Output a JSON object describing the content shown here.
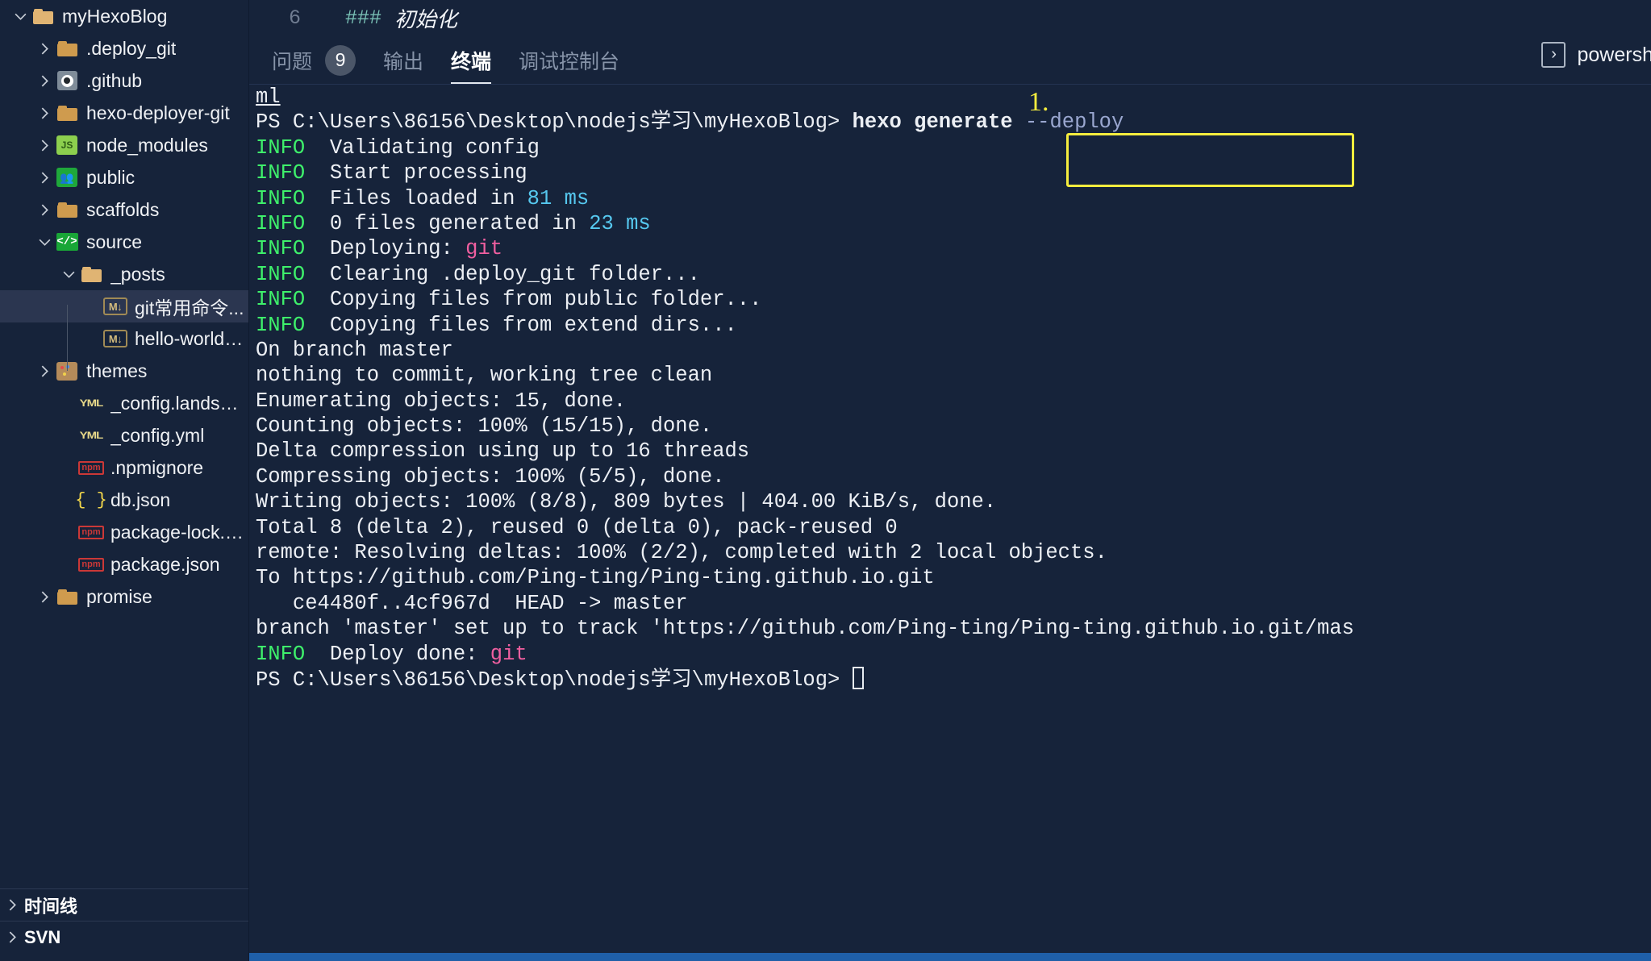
{
  "sidebar": {
    "tree": [
      {
        "label": "myHexoBlog",
        "icon": "folder-open-icon",
        "indent": 0,
        "chevron": "down",
        "selected": false
      },
      {
        "label": ".deploy_git",
        "icon": "folder-icon",
        "indent": 1,
        "chevron": "right",
        "selected": false
      },
      {
        "label": ".github",
        "icon": "github-icon",
        "indent": 1,
        "chevron": "right",
        "selected": false
      },
      {
        "label": "hexo-deployer-git",
        "icon": "folder-icon",
        "indent": 1,
        "chevron": "right",
        "selected": false
      },
      {
        "label": "node_modules",
        "icon": "node-folder-icon",
        "indent": 1,
        "chevron": "right",
        "selected": false
      },
      {
        "label": "public",
        "icon": "public-folder-icon",
        "indent": 1,
        "chevron": "right",
        "selected": false
      },
      {
        "label": "scaffolds",
        "icon": "folder-icon",
        "indent": 1,
        "chevron": "right",
        "selected": false
      },
      {
        "label": "source",
        "icon": "source-folder-icon",
        "indent": 1,
        "chevron": "down",
        "selected": false
      },
      {
        "label": "_posts",
        "icon": "folder-open-icon",
        "indent": 2,
        "chevron": "down",
        "selected": false
      },
      {
        "label": "git常用命令...",
        "icon": "markdown-icon",
        "indent": 3,
        "chevron": "none",
        "selected": true
      },
      {
        "label": "hello-world.md",
        "icon": "markdown-icon",
        "indent": 3,
        "chevron": "none",
        "selected": false
      },
      {
        "label": "themes",
        "icon": "theme-folder-icon",
        "indent": 1,
        "chevron": "right",
        "selected": false
      },
      {
        "label": "_config.landscap...",
        "icon": "yaml-icon",
        "indent": 2,
        "chevron": "none",
        "selected": false
      },
      {
        "label": "_config.yml",
        "icon": "yaml-icon",
        "indent": 2,
        "chevron": "none",
        "selected": false
      },
      {
        "label": ".npmignore",
        "icon": "npm-icon",
        "indent": 2,
        "chevron": "none",
        "selected": false
      },
      {
        "label": "db.json",
        "icon": "json-icon",
        "indent": 2,
        "chevron": "none",
        "selected": false
      },
      {
        "label": "package-lock.json",
        "icon": "npm-icon",
        "indent": 2,
        "chevron": "none",
        "selected": false
      },
      {
        "label": "package.json",
        "icon": "npm-icon",
        "indent": 2,
        "chevron": "none",
        "selected": false
      },
      {
        "label": "promise",
        "icon": "folder-icon",
        "indent": 1,
        "chevron": "right",
        "selected": false
      }
    ],
    "sections": [
      {
        "label": "时间线",
        "chevron": "right"
      },
      {
        "label": "SVN",
        "chevron": "right"
      }
    ]
  },
  "editor": {
    "line_number": "6",
    "md_marker": "###",
    "md_heading": "初始化"
  },
  "panel": {
    "tabs": [
      {
        "label": "问题",
        "badge": "9",
        "active": false
      },
      {
        "label": "输出",
        "badge": null,
        "active": false
      },
      {
        "label": "终端",
        "badge": null,
        "active": true
      },
      {
        "label": "调试控制台",
        "badge": null,
        "active": false
      }
    ],
    "shell_label": "powershell",
    "shell_icon": "chevron-right-boxed-icon"
  },
  "annotation": {
    "step_marker": "1."
  },
  "terminal": {
    "prompt": "PS C:\\Users\\86156\\Desktop\\nodejs学习\\myHexoBlog>",
    "command": "hexo generate",
    "command_flag": "--deploy",
    "scrollback_fragment": "ml",
    "lines": [
      {
        "type": "fragment",
        "text": "ml"
      },
      {
        "type": "prompt-cmd"
      },
      {
        "type": "info",
        "tag": "INFO",
        "text": "Validating config"
      },
      {
        "type": "info",
        "tag": "INFO",
        "text": "Start processing"
      },
      {
        "type": "info-num",
        "tag": "INFO",
        "pre": "Files loaded in ",
        "num": "81 ms",
        "post": ""
      },
      {
        "type": "info-num",
        "tag": "INFO",
        "pre": "0 files generated in ",
        "num": "23 ms",
        "post": ""
      },
      {
        "type": "info-mag",
        "tag": "INFO",
        "pre": "Deploying: ",
        "mag": "git",
        "post": ""
      },
      {
        "type": "info",
        "tag": "INFO",
        "text": "Clearing .deploy_git folder..."
      },
      {
        "type": "info",
        "tag": "INFO",
        "text": "Copying files from public folder..."
      },
      {
        "type": "info",
        "tag": "INFO",
        "text": "Copying files from extend dirs..."
      },
      {
        "type": "plain",
        "text": "On branch master"
      },
      {
        "type": "plain",
        "text": "nothing to commit, working tree clean"
      },
      {
        "type": "plain",
        "text": "Enumerating objects: 15, done."
      },
      {
        "type": "plain",
        "text": "Counting objects: 100% (15/15), done."
      },
      {
        "type": "plain",
        "text": "Delta compression using up to 16 threads"
      },
      {
        "type": "plain",
        "text": "Compressing objects: 100% (5/5), done."
      },
      {
        "type": "plain",
        "text": "Writing objects: 100% (8/8), 809 bytes | 404.00 KiB/s, done."
      },
      {
        "type": "plain",
        "text": "Total 8 (delta 2), reused 0 (delta 0), pack-reused 0"
      },
      {
        "type": "plain",
        "text": "remote: Resolving deltas: 100% (2/2), completed with 2 local objects."
      },
      {
        "type": "plain",
        "text": "To https://github.com/Ping-ting/Ping-ting.github.io.git"
      },
      {
        "type": "plain",
        "text": "   ce4480f..4cf967d  HEAD -> master"
      },
      {
        "type": "plain",
        "text": "branch 'master' set up to track 'https://github.com/Ping-ting/Ping-ting.github.io.git/mas"
      },
      {
        "type": "info-mag",
        "tag": "INFO",
        "pre": "Deploy done: ",
        "mag": "git",
        "post": ""
      },
      {
        "type": "prompt-cursor"
      }
    ]
  },
  "colors": {
    "background": "#16233a",
    "sidebar_selected": "#2b3650",
    "info_green": "#3ef06b",
    "number_cyan": "#56c8ef",
    "magenta": "#f05fa0",
    "annotation_yellow": "#f5ed3e",
    "status_blue": "#1f5fa8"
  }
}
